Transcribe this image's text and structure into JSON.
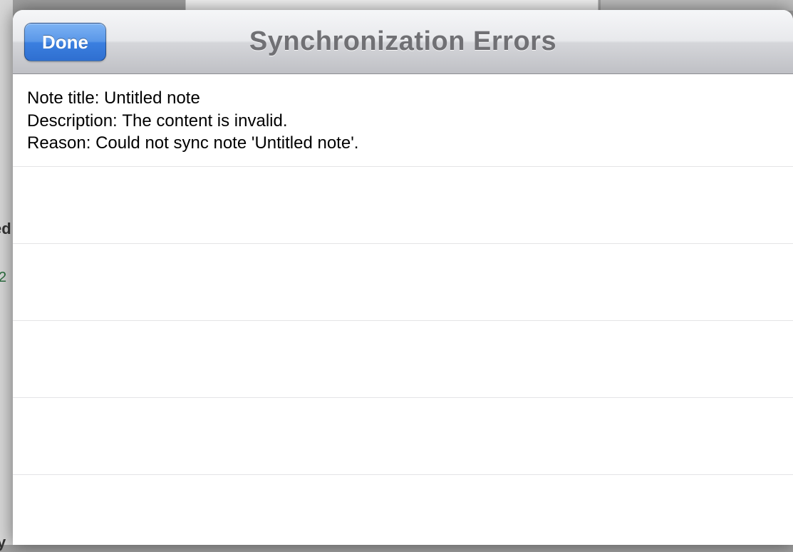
{
  "header": {
    "done_label": "Done",
    "title": "Synchronization Errors"
  },
  "error": {
    "labels": {
      "note_title": "Note title: ",
      "description": "Description: ",
      "reason": "Reason: "
    },
    "note_title": "Untitled note",
    "description": "The content is invalid.",
    "reason": "Could not sync note 'Untitled note'."
  },
  "background": {
    "left_fragment_1": "ed",
    "left_fragment_2": "2",
    "left_fragment_3": "y"
  }
}
